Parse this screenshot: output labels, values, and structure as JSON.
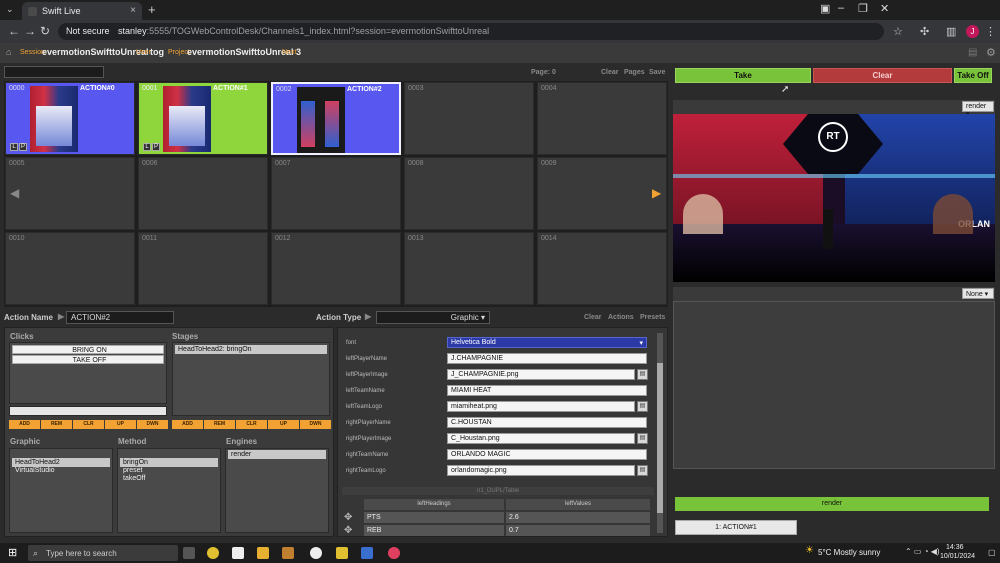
{
  "browser": {
    "tab_title": "Swift Live",
    "not_secure": "Not secure",
    "url_host": "stanley",
    "url_rest": ":5555/TOGWebControlDesk/Channels1_index.html?session=evermotionSwifttoUnreal",
    "profile_letter": "J"
  },
  "header": {
    "session_label": "Session:",
    "session_value": "evermotionSwifttoUnreal",
    "user_label": "User:",
    "user_value": "tog",
    "project_label": "Project:",
    "project_value": "evermotionSwifttoUnreal",
    "next_label": "Next:",
    "next_value": "3"
  },
  "grid_toolbar": {
    "page": "Page: 0",
    "clear": "Clear",
    "pages": "Pages",
    "save": "Save"
  },
  "cells": [
    {
      "num": "0000",
      "label": "ACTION#0"
    },
    {
      "num": "0001",
      "label": "ACTION#1"
    },
    {
      "num": "0002",
      "label": "ACTION#2"
    },
    {
      "num": "0003",
      "label": ""
    },
    {
      "num": "0004",
      "label": ""
    },
    {
      "num": "0005",
      "label": ""
    },
    {
      "num": "0006",
      "label": ""
    },
    {
      "num": "0007",
      "label": ""
    },
    {
      "num": "0008",
      "label": ""
    },
    {
      "num": "0009",
      "label": ""
    },
    {
      "num": "0010",
      "label": ""
    },
    {
      "num": "0011",
      "label": ""
    },
    {
      "num": "0012",
      "label": ""
    },
    {
      "num": "0013",
      "label": ""
    },
    {
      "num": "0014",
      "label": ""
    }
  ],
  "lp": {
    "l": "L",
    "p": "P"
  },
  "action": {
    "name_label": "Action Name",
    "name_value": "ACTION#2",
    "type_label": "Action Type",
    "type_value": "Graphic",
    "clear": "Clear",
    "actions": "Actions",
    "presets": "Presets"
  },
  "clicks": {
    "title": "Clicks",
    "items": [
      "BRING ON",
      "TAKE OFF"
    ]
  },
  "stages": {
    "title": "Stages",
    "items": [
      "HeadToHead2: bringOn"
    ]
  },
  "buttons": [
    "ADD",
    "REM",
    "CLR",
    "UP",
    "DWN"
  ],
  "graphic": {
    "title": "Graphic",
    "items": [
      "HeadToHead2",
      "VirtualStudio"
    ]
  },
  "method": {
    "title": "Method",
    "items": [
      "bringOn",
      "preset",
      "takeOff"
    ]
  },
  "engines": {
    "title": "Engines",
    "items": [
      "render"
    ]
  },
  "properties": [
    {
      "key": "font",
      "value": "Helvetica Bold"
    },
    {
      "key": "leftPlayerName",
      "value": "J.CHAMPAGNIE"
    },
    {
      "key": "leftPlayerImage",
      "value": "J_CHAMPAGNIE.png"
    },
    {
      "key": "leftTeamName",
      "value": "MIAMI HEAT"
    },
    {
      "key": "leftTeamLogo",
      "value": "miamiheat.png"
    },
    {
      "key": "rightPlayerName",
      "value": "C.HOUSTAN"
    },
    {
      "key": "rightPlayerImage",
      "value": "C_Houstan.png"
    },
    {
      "key": "rightTeamName",
      "value": "ORLANDO MAGIC"
    },
    {
      "key": "rightTeamLogo",
      "value": "orlandomagic.png"
    }
  ],
  "table": {
    "title": "n1_DUPL/Table",
    "headers": [
      "leftHeadings",
      "leftValues"
    ],
    "rows": [
      [
        "PTS",
        "2.6"
      ],
      [
        "REB",
        "0.7"
      ]
    ]
  },
  "right": {
    "take": "Take",
    "clear": "Clear",
    "take_off": "Take Off",
    "preview_select": "render",
    "second_select": "None",
    "render_button": "render",
    "current_action": "1: ACTION#1",
    "preview_logo": "RT",
    "preview_text": "ORLAN"
  },
  "taskbar": {
    "search": "Type here to search",
    "weather": "5°C  Mostly sunny",
    "time": "14:36",
    "date": "10/01/2024"
  }
}
